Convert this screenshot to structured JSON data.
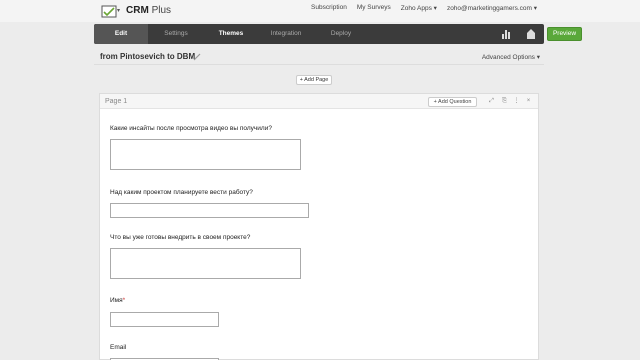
{
  "app": {
    "name": "CRM",
    "name_suffix": "Plus"
  },
  "top_links": {
    "subscription": "Subscription",
    "my_surveys": "My Surveys",
    "zoho_apps": "Zoho Apps ▾",
    "user": "zoho@marketinggamers.com ▾"
  },
  "nav": {
    "tabs": [
      "Edit",
      "Settings",
      "Themes",
      "Integration",
      "Deploy"
    ],
    "active_tab": "Edit",
    "preview_label": "Preview",
    "icons": [
      "bar-chart-icon",
      "share-icon"
    ]
  },
  "survey": {
    "title": "from Pintosevich to DBM",
    "advanced_options": "Advanced Options ▾"
  },
  "add_page_label": "+ Add Page",
  "page": {
    "label": "Page 1",
    "add_question_label": "+ Add Question",
    "icons": [
      "expand-icon",
      "copy-icon",
      "more-icon",
      "close-icon"
    ]
  },
  "questions": [
    {
      "label": "Какие инсайты после просмотра видео вы получили?",
      "required": false,
      "type": "textarea"
    },
    {
      "label": "Над каким проектом планируете вести работу?",
      "required": false,
      "type": "text"
    },
    {
      "label": "Что вы уже готовы внедрить в своем проекте?",
      "required": false,
      "type": "textarea"
    },
    {
      "label": "Имя",
      "required": true,
      "required_mark": "*",
      "type": "text-short"
    },
    {
      "label": "Email",
      "required": false,
      "type": "text-short"
    }
  ],
  "colors": {
    "navbar": "#3b3b3b",
    "preview": "#5aa83a",
    "background": "#ececec"
  }
}
